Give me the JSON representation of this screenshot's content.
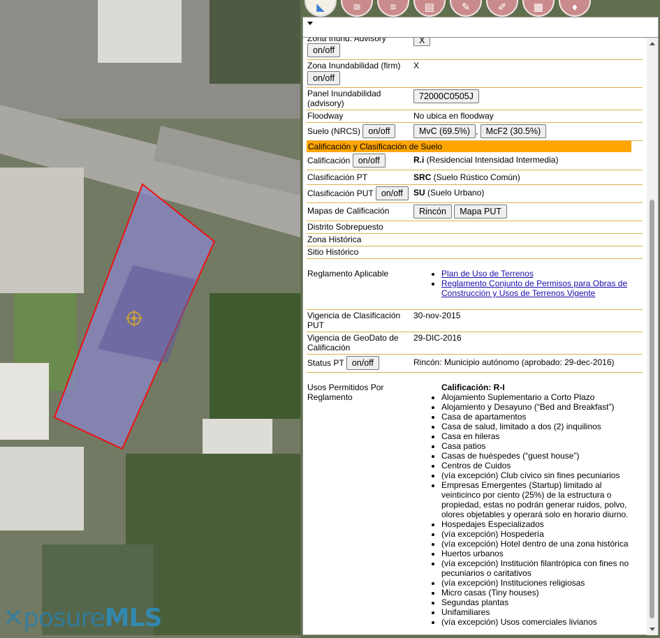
{
  "toolbar": {
    "icons": [
      "map-layers-icon",
      "layers-icon",
      "stack-icon",
      "print-icon",
      "tools-icon",
      "edit-icon",
      "document-icon",
      "pin-icon"
    ]
  },
  "logo": {
    "part1": "posure",
    "part2": "MLS"
  },
  "rows": {
    "zona_advisory": {
      "label": "Zona Inund. Advisory",
      "btn": "on/off",
      "value": "X"
    },
    "zona_firm": {
      "label": "Zona Inundabilidad (firm)",
      "btn": "on/off",
      "value": "X"
    },
    "panel": {
      "label": "Panel Inundabilidad (advisory)",
      "value": "72000C0505J"
    },
    "floodway": {
      "label": "Floodway",
      "value": "No ubica en floodway"
    },
    "suelo": {
      "label": "Suelo (NRCS)",
      "btn": "on/off",
      "v1": "MvC (69.5%)",
      "sep": ",",
      "v2": "McF2 (30.5%)"
    },
    "section": "Calificación y Clasificación de Suelo",
    "calificacion": {
      "label": "Calificación",
      "btn": "on/off",
      "code": "R.i",
      "desc": " (Residencial Intensidad Intermedia)"
    },
    "clas_pt": {
      "label": "Clasificación PT",
      "code": "SRC",
      "desc": " (Suelo Rústico Común)"
    },
    "clas_put": {
      "label": "Clasificación PUT",
      "btn": "on/off",
      "code": "SU",
      "desc": " (Suelo Urbano)"
    },
    "mapas": {
      "label": "Mapas de Calificación",
      "b1": "Rincón",
      "b2": "Mapa PUT"
    },
    "distrito": {
      "label": "Distrito Sobrepuesto"
    },
    "zona_hist": {
      "label": "Zona Histórica"
    },
    "sitio_hist": {
      "label": "Sitio Histórico"
    },
    "reglamento": {
      "label": "Reglamento Aplicable",
      "links": [
        "Plan de Uso de Terrenos",
        "Reglamento Conjunto de Permisos para Obras de Construcción y Usos de Terrenos Vigente"
      ]
    },
    "vigencia_clas": {
      "label": "Vigencia de Clasificación PUT",
      "value": "30-nov-2015"
    },
    "vigencia_geo": {
      "label": "Vigencia de GeoDato de Calificación",
      "value": "29-DIC-2016"
    },
    "status": {
      "label": "Status PT",
      "btn": "on/off",
      "value": "Rincón: Municipio autónomo (aprobado: 29-dec-2016)"
    },
    "usos": {
      "label": "Usos Permitidos Por Reglamento",
      "heading": "Calificación: R-I",
      "items": [
        "Alojamiento Suplementario a Corto Plazo",
        "Alojamiento y Desayuno (“Bed and Breakfast”)",
        "Casa de apartamentos",
        "Casa de salud, limitado a dos (2) inquilinos",
        "Casa en hileras",
        "Casa patios",
        "Casas de huéspedes (“guest house”)",
        "Centros de Cuidos",
        "(vía excepción) Club cívico sin fines pecuniarios",
        "Empresas Emergentes (Startup) limitado al veinticinco por ciento (25%) de la estructura o propiedad, estas no podrán generar ruidos, polvo, olores objetables y operará solo en horario diurno.",
        "Hospedajes Especializados",
        "(vía excepción) Hospedería",
        "(vía excepción) Hotel dentro de una zona histórica",
        "Huertos urbanos",
        "(vía excepción) Institución filantrópica con fines no pecuniarios o caritativos",
        "(vía excepción) Instituciones religiosas",
        "Micro casas (Tiny houses)",
        "Segundas plantas",
        "Unifamiliares",
        "(vía excepción) Usos comerciales livianos"
      ]
    }
  }
}
